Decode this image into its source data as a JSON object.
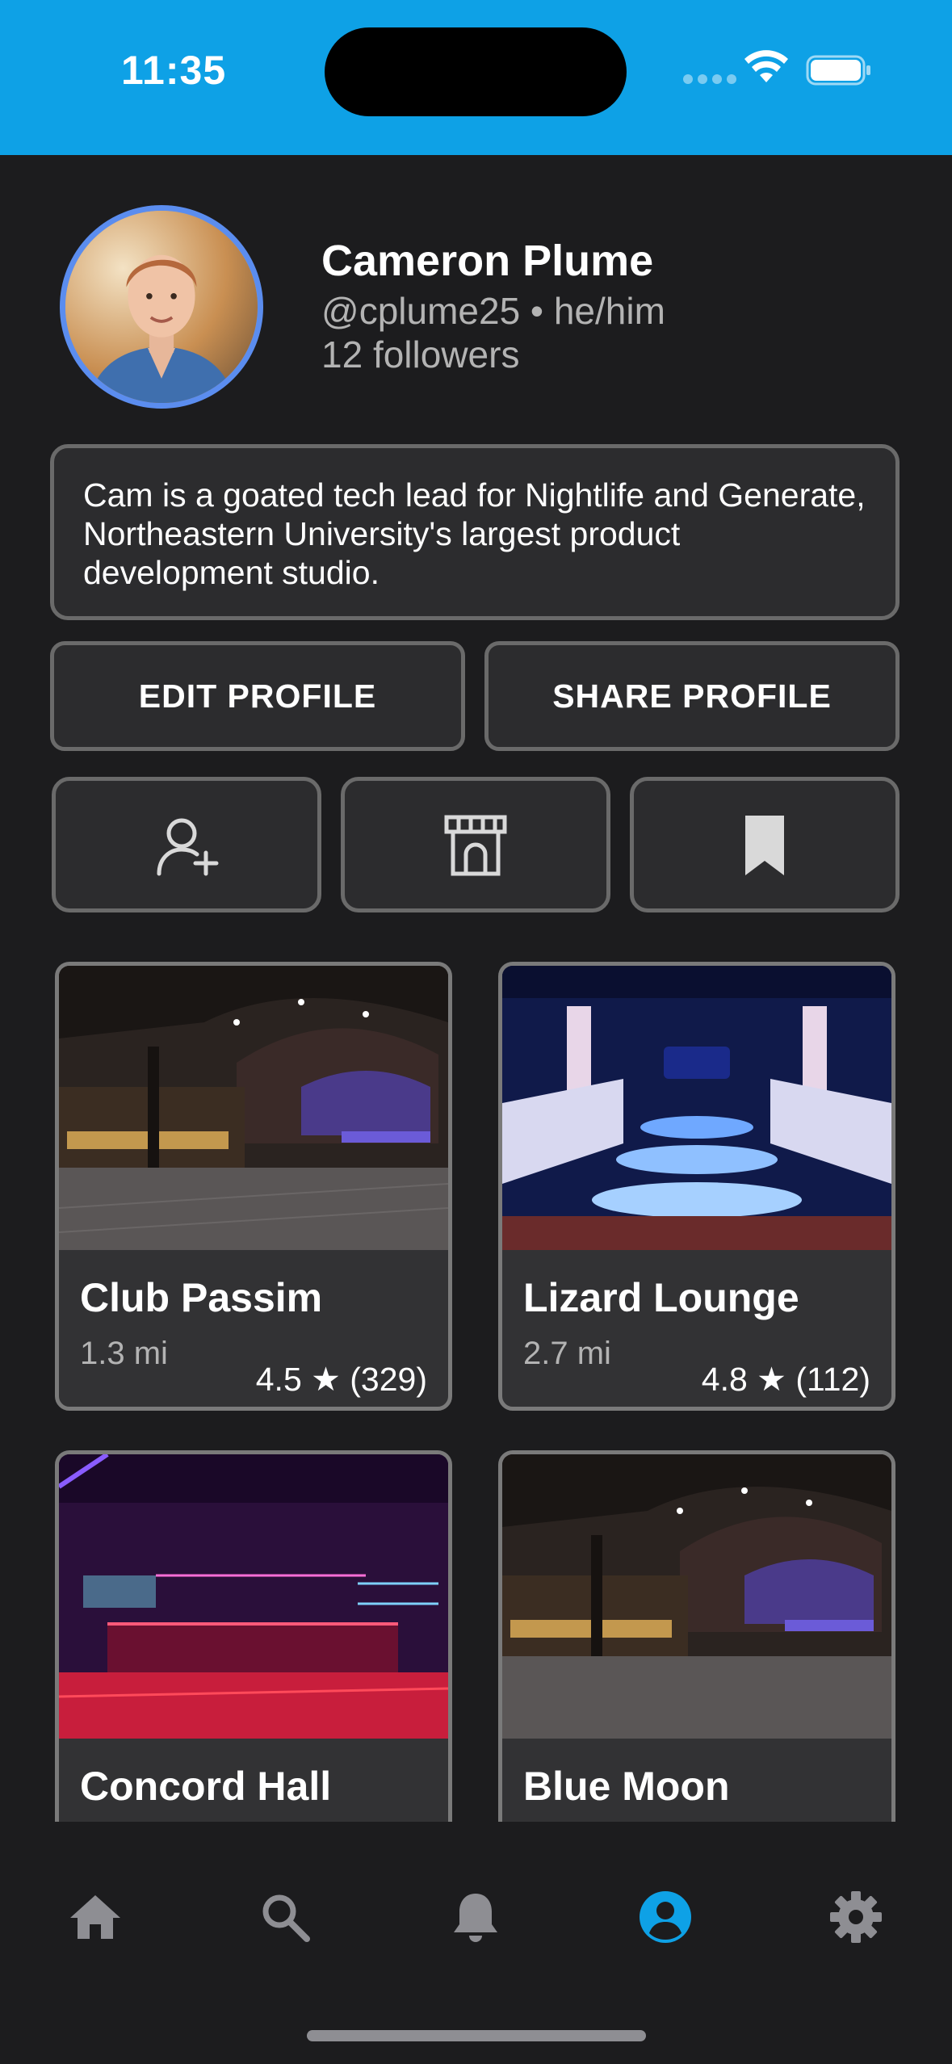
{
  "status_bar": {
    "time": "11:35",
    "color": "#0ea1e6"
  },
  "profile": {
    "name": "Cameron Plume",
    "handle_pronouns": "@cplume25 • he/him",
    "followers": "12 followers",
    "bio": "Cam is a goated tech lead for Nightlife and Generate, Northeastern University's largest product development studio."
  },
  "actions": {
    "edit_label": "EDIT PROFILE",
    "share_label": "SHARE PROFILE"
  },
  "icon_buttons": [
    "add-friend-icon",
    "venue-storefront-icon",
    "bookmark-icon"
  ],
  "venues": [
    {
      "name": "Club Passim",
      "distance": "1.3 mi",
      "rating": "4.5 ★ (329)"
    },
    {
      "name": "Lizard Lounge",
      "distance": "2.7 mi",
      "rating": "4.8 ★ (112)"
    },
    {
      "name": "Concord Hall",
      "distance": "",
      "rating": ""
    },
    {
      "name": "Blue Moon",
      "distance": "",
      "rating": ""
    }
  ],
  "tabs": [
    {
      "icon": "home-icon",
      "active": false
    },
    {
      "icon": "search-icon",
      "active": false
    },
    {
      "icon": "bell-icon",
      "active": false
    },
    {
      "icon": "profile-icon",
      "active": true
    },
    {
      "icon": "settings-icon",
      "active": false
    }
  ],
  "colors": {
    "accent": "#0ea1e6",
    "background": "#1c1c1e",
    "card": "#2c2c2e",
    "avatar_ring": "#5b8def",
    "inactive_icon": "#8e8e93"
  }
}
